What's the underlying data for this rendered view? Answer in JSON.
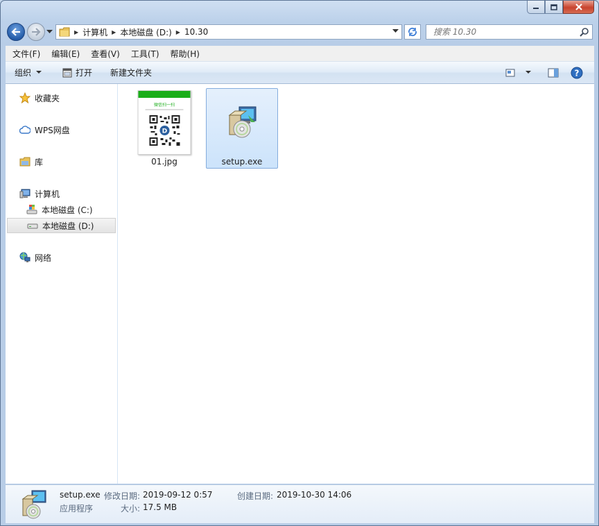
{
  "breadcrumb": {
    "items": [
      "计算机",
      "本地磁盘 (D:)",
      "10.30"
    ]
  },
  "search": {
    "placeholder": "搜索 10.30"
  },
  "menu": [
    "文件(F)",
    "编辑(E)",
    "查看(V)",
    "工具(T)",
    "帮助(H)"
  ],
  "commands": {
    "organize": "组织",
    "open": "打开",
    "new_folder": "新建文件夹"
  },
  "sidebar": {
    "favorites": "收藏夹",
    "wps": "WPS网盘",
    "library": "库",
    "computer": "计算机",
    "drive_c": "本地磁盘 (C:)",
    "drive_d": "本地磁盘 (D:)",
    "network": "网络"
  },
  "files": [
    {
      "name": "01.jpg",
      "icon": "qr-image-thumbnail"
    },
    {
      "name": "setup.exe",
      "icon": "installer-icon"
    }
  ],
  "thumbnail": {
    "header": "微信扫一扫",
    "badge": "D"
  },
  "details": {
    "name": "setup.exe",
    "type": "应用程序",
    "modified_label": "修改日期:",
    "modified_value": "2019-09-12 0:57",
    "created_label": "创建日期:",
    "created_value": "2019-10-30 14:06",
    "size_label": "大小:",
    "size_value": "17.5 MB"
  },
  "colors": {
    "selection": "#cce3fb",
    "accent": "#3a75c4",
    "wechat_green": "#1aad19"
  }
}
